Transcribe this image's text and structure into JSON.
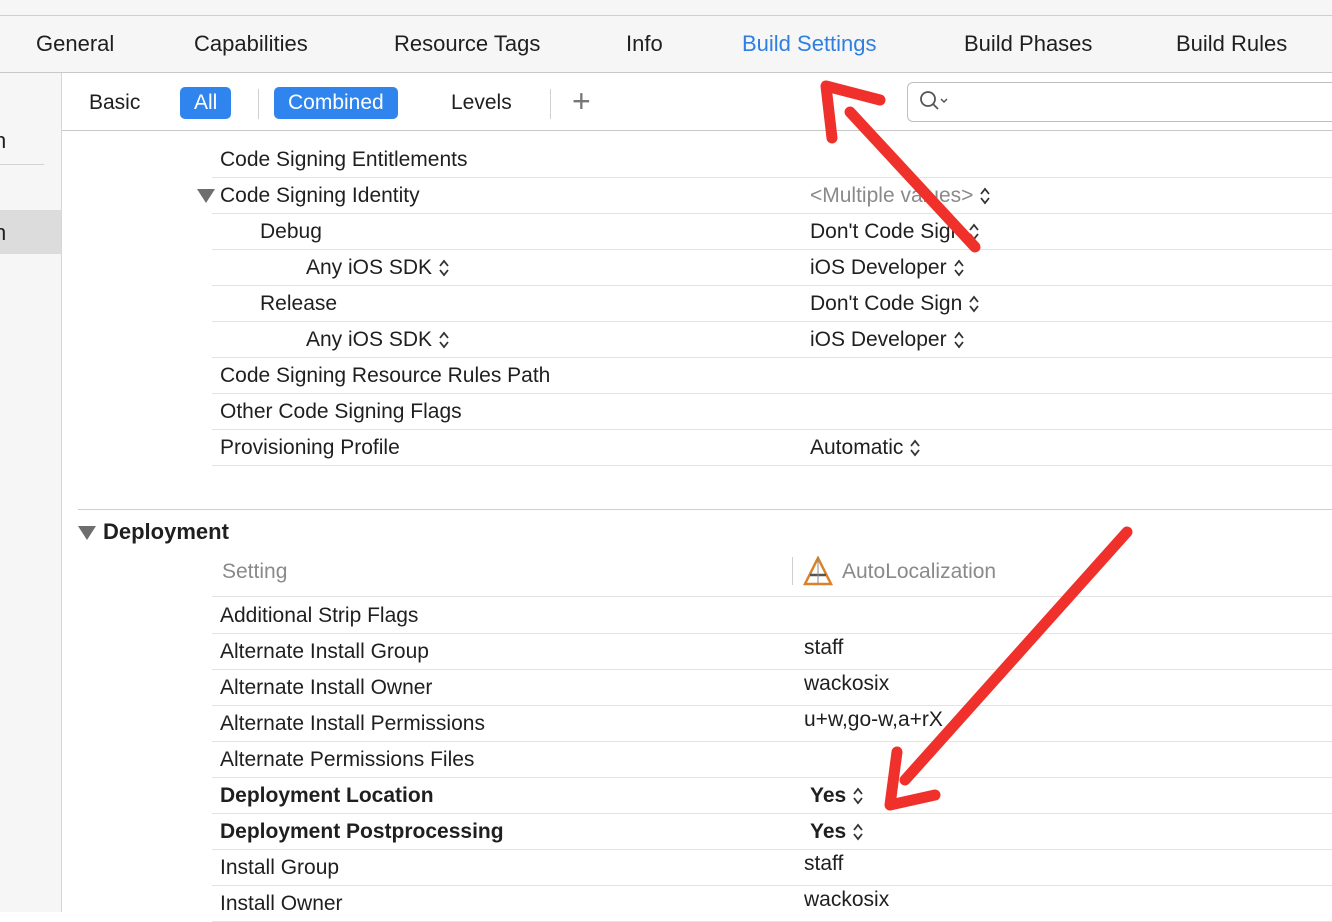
{
  "tabs": [
    "General",
    "Capabilities",
    "Resource Tags",
    "Info",
    "Build Settings",
    "Build Phases",
    "Build Rules"
  ],
  "active_tab": "Build Settings",
  "filter": {
    "basic": "Basic",
    "all": "All",
    "combined": "Combined",
    "levels": "Levels",
    "add": "+"
  },
  "search": {
    "placeholder": ""
  },
  "sidebar": {
    "frag1": "n",
    "frag2": "n"
  },
  "code_signing": {
    "entitlements": "Code Signing Entitlements",
    "identity": "Code Signing Identity",
    "identity_value": "<Multiple values>",
    "debug": "Debug",
    "debug_value": "Don't Code Sign",
    "debug_sdk": "Any iOS SDK",
    "debug_sdk_value": "iOS Developer",
    "release": "Release",
    "release_value": "Don't Code Sign",
    "release_sdk": "Any iOS SDK",
    "release_sdk_value": "iOS Developer",
    "resource_rules": "Code Signing Resource Rules Path",
    "other_flags": "Other Code Signing Flags",
    "provisioning": "Provisioning Profile",
    "provisioning_value": "Automatic"
  },
  "deployment": {
    "title": "Deployment",
    "header_setting": "Setting",
    "header_target": "AutoLocalization",
    "rows": [
      {
        "label": "Additional Strip Flags",
        "value": "",
        "bold": false,
        "stepper": false
      },
      {
        "label": "Alternate Install Group",
        "value": "staff",
        "bold": false,
        "stepper": false
      },
      {
        "label": "Alternate Install Owner",
        "value": "wackosix",
        "bold": false,
        "stepper": false
      },
      {
        "label": "Alternate Install Permissions",
        "value": "u+w,go-w,a+rX",
        "bold": false,
        "stepper": false
      },
      {
        "label": "Alternate Permissions Files",
        "value": "",
        "bold": false,
        "stepper": false
      },
      {
        "label": "Deployment Location",
        "value": "Yes",
        "bold": true,
        "stepper": true
      },
      {
        "label": "Deployment Postprocessing",
        "value": "Yes",
        "bold": true,
        "stepper": true
      },
      {
        "label": "Install Group",
        "value": "staff",
        "bold": false,
        "stepper": false
      },
      {
        "label": "Install Owner",
        "value": "wackosix",
        "bold": false,
        "stepper": false
      }
    ]
  },
  "colors": {
    "accent": "#2f84ee",
    "arrow": "#f0302a"
  }
}
